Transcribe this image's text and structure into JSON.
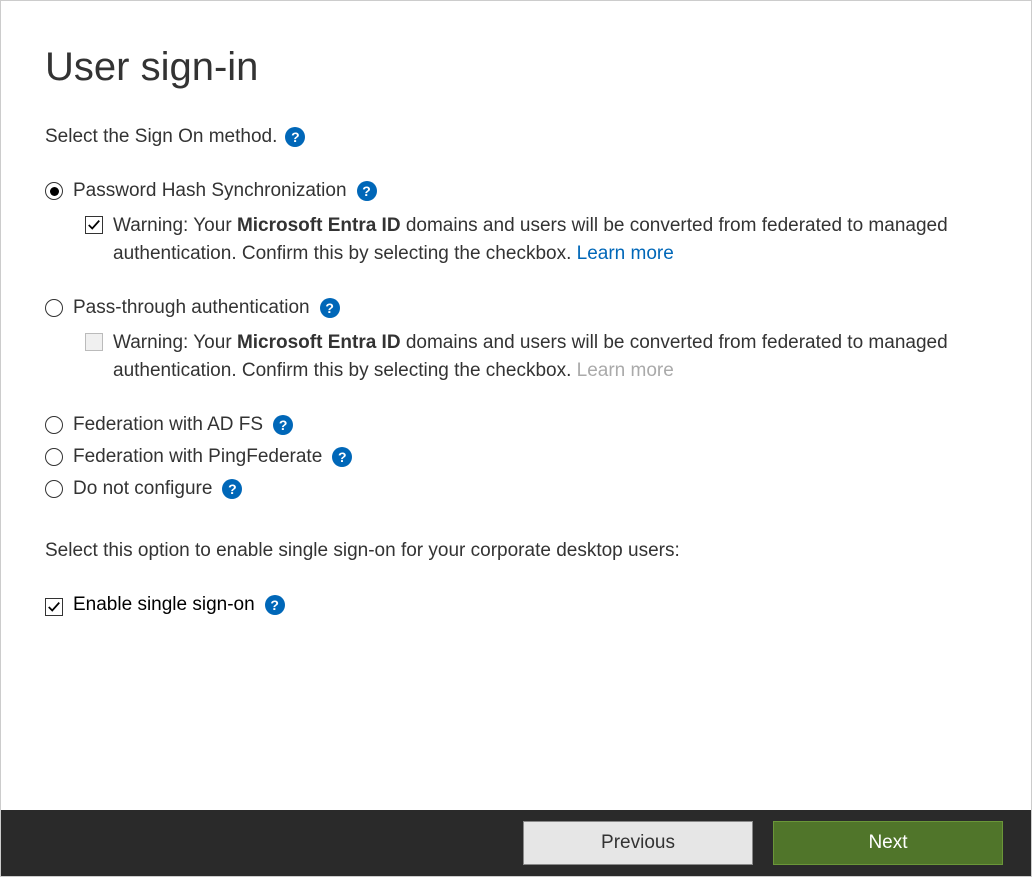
{
  "page": {
    "title": "User sign-in",
    "prompt": "Select the Sign On method."
  },
  "options": {
    "phs": {
      "label": "Password Hash Synchronization",
      "selected": true,
      "warning": {
        "checked": true,
        "prefix": "Warning: Your ",
        "bold": "Microsoft Entra ID",
        "suffix": " domains and users will be converted from federated to managed authentication. Confirm this by selecting the checkbox. ",
        "learn": "Learn more"
      }
    },
    "pta": {
      "label": "Pass-through authentication",
      "selected": false,
      "warning": {
        "checked": false,
        "disabled": true,
        "prefix": "Warning: Your ",
        "bold": "Microsoft Entra ID",
        "suffix": " domains and users will be converted from federated to managed authentication. Confirm this by selecting the checkbox. ",
        "learn": "Learn more"
      }
    },
    "adfs": {
      "label": "Federation with AD FS",
      "selected": false
    },
    "ping": {
      "label": "Federation with PingFederate",
      "selected": false
    },
    "none": {
      "label": "Do not configure",
      "selected": false
    }
  },
  "sso": {
    "prompt": "Select this option to enable single sign-on for your corporate desktop users:",
    "label": "Enable single sign-on",
    "checked": true
  },
  "footer": {
    "prev": "Previous",
    "next": "Next"
  }
}
